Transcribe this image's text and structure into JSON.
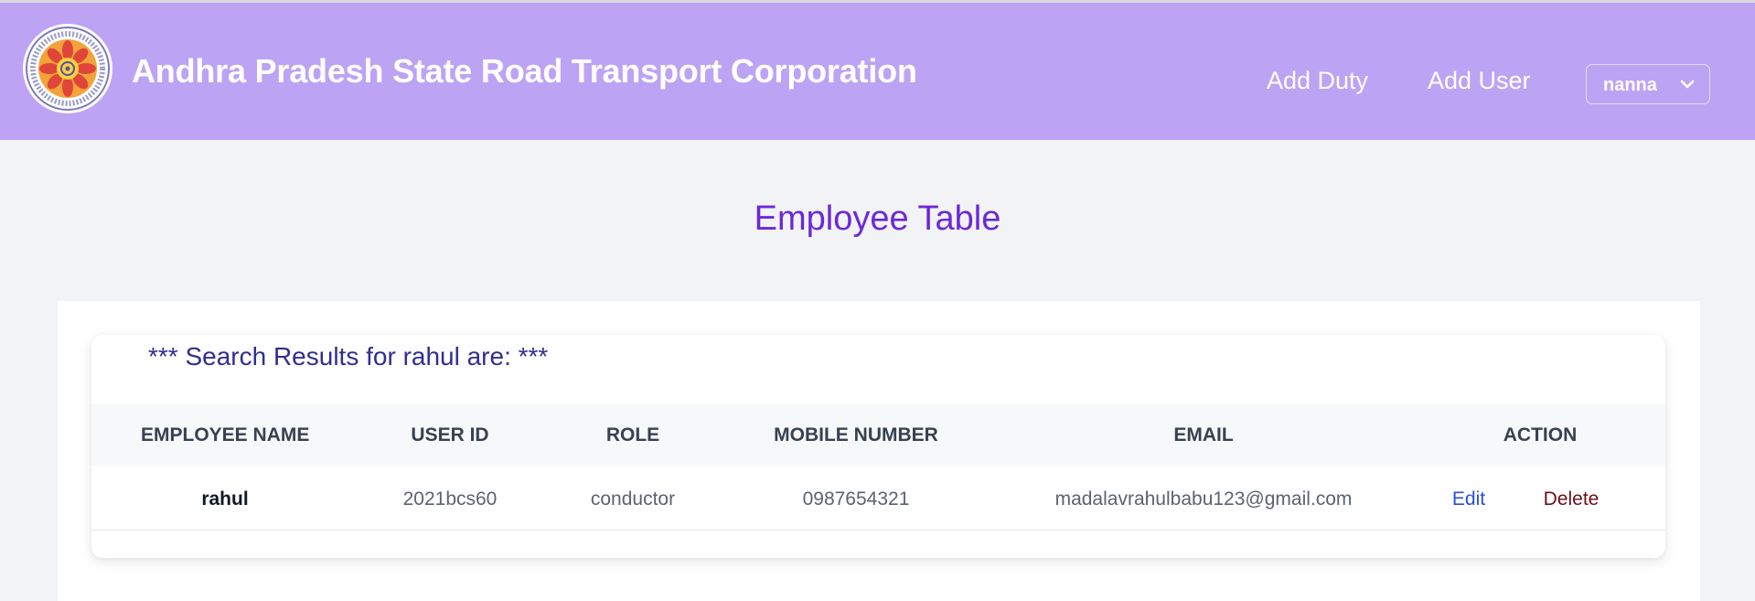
{
  "colors": {
    "navbar_bg": "#bda3f4",
    "page_bg": "#f2f3f5",
    "title": "#6d28d9",
    "search_heading": "#312e91",
    "edit": "#2b4fd8",
    "delete": "#6b0f1a"
  },
  "header": {
    "logo_icon": "apsrtc-emblem-icon",
    "title": "Andhra Pradesh State Road Transport Corporation",
    "nav": {
      "add_duty": "Add Duty",
      "add_user": "Add User"
    },
    "user_menu": {
      "username": "nanna",
      "icon": "chevron-down-icon"
    }
  },
  "main": {
    "title": "Employee Table",
    "search_heading": "*** Search Results for rahul are: ***",
    "table": {
      "columns": [
        "EMPLOYEE NAME",
        "USER ID",
        "ROLE",
        "MOBILE NUMBER",
        "EMAIL",
        "ACTION"
      ],
      "rows": [
        {
          "employee_name": "rahul",
          "user_id": "2021bcs60",
          "role": "conductor",
          "mobile_number": "0987654321",
          "email": "madalavrahulbabu123@gmail.com",
          "edit_label": "Edit",
          "delete_label": "Delete"
        }
      ]
    }
  }
}
